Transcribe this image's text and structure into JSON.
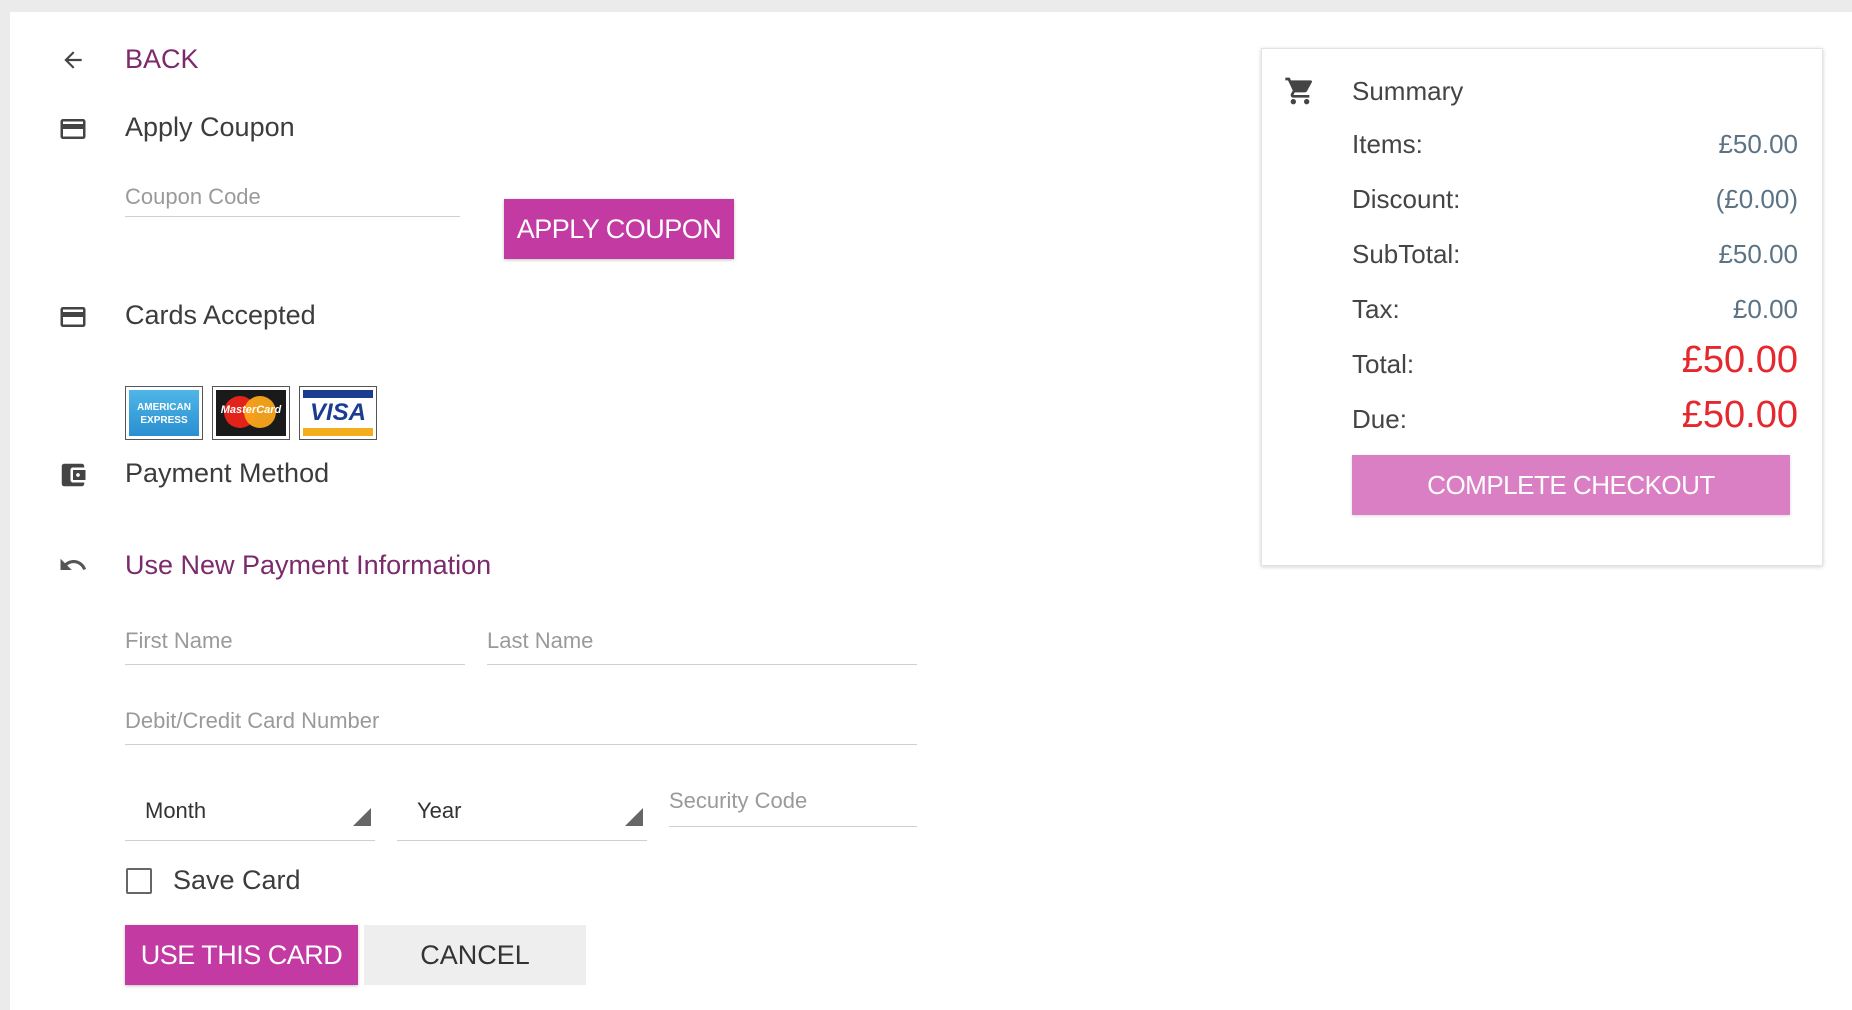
{
  "nav": {
    "back_label": "BACK"
  },
  "coupon": {
    "title": "Apply Coupon",
    "code_placeholder": "Coupon Code",
    "apply_label": "APPLY COUPON"
  },
  "cards": {
    "title": "Cards Accepted",
    "logos": [
      {
        "name": "amex",
        "line1": "AMERICAN",
        "line2": "EXPRESS"
      },
      {
        "name": "mastercard",
        "text": "MasterCard"
      },
      {
        "name": "visa",
        "text": "VISA"
      }
    ]
  },
  "payment": {
    "title": "Payment Method",
    "new_payment_label": "Use New Payment Information",
    "first_name_placeholder": "First Name",
    "last_name_placeholder": "Last Name",
    "card_number_placeholder": "Debit/Credit Card Number",
    "month_value": "Month",
    "year_value": "Year",
    "security_code_placeholder": "Security Code",
    "save_card_label": "Save Card",
    "use_card_label": "USE THIS CARD",
    "cancel_label": "CANCEL"
  },
  "summary": {
    "title": "Summary",
    "rows": [
      {
        "label": "Items:",
        "value": "£50.00"
      },
      {
        "label": "Discount:",
        "value": "(£0.00)"
      },
      {
        "label": "SubTotal:",
        "value": "£50.00"
      },
      {
        "label": "Tax:",
        "value": "£0.00"
      },
      {
        "label": "Total:",
        "value": "£50.00"
      },
      {
        "label": "Due:",
        "value": "£50.00"
      }
    ],
    "complete_label": "COMPLETE CHECKOUT"
  },
  "colors": {
    "accent": "#c33aa3",
    "accent_light": "#db7fc4",
    "link_purple": "#7b2a6b",
    "total_red": "#e5282e",
    "value_gray_blue": "#5b7384"
  },
  "icons": {
    "back": "arrow-left-icon",
    "coupon": "credit-card-icon",
    "cards": "credit-card-icon",
    "payment": "wallet-icon",
    "new_payment": "undo-icon",
    "summary": "cart-icon"
  }
}
